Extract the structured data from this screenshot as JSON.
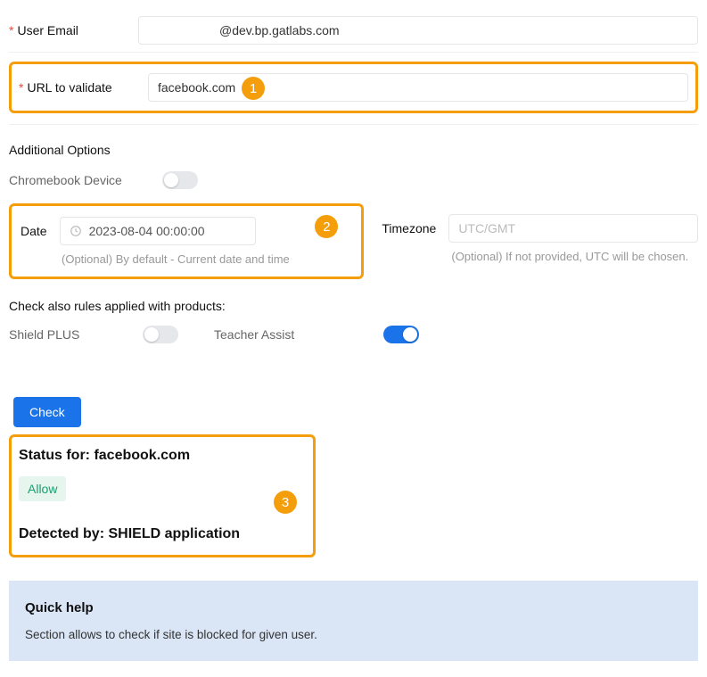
{
  "fields": {
    "user_email": {
      "label": "User Email",
      "value": "@dev.bp.gatlabs.com"
    },
    "url_to_validate": {
      "label": "URL to validate",
      "value": "facebook.com"
    }
  },
  "additional_options": {
    "title": "Additional Options",
    "chromebook_label": "Chromebook Device"
  },
  "date": {
    "label": "Date",
    "value": "2023-08-04 00:00:00",
    "hint": "(Optional) By default - Current date and time"
  },
  "timezone": {
    "label": "Timezone",
    "placeholder": "UTC/GMT",
    "hint": "(Optional) If not provided, UTC will be chosen."
  },
  "rules": {
    "title": "Check also rules applied with products:",
    "shield_plus": "Shield PLUS",
    "teacher_assist": "Teacher Assist"
  },
  "check_button": "Check",
  "result": {
    "status_for_label": "Status for:",
    "status_site": "facebook.com",
    "verdict": "Allow",
    "detected_by_label": "Detected by:",
    "detected_by_value": "SHIELD application"
  },
  "callouts": {
    "c1": "1",
    "c2": "2",
    "c3": "3"
  },
  "help": {
    "title": "Quick help",
    "text": "Section allows to check if site is blocked for given user."
  }
}
